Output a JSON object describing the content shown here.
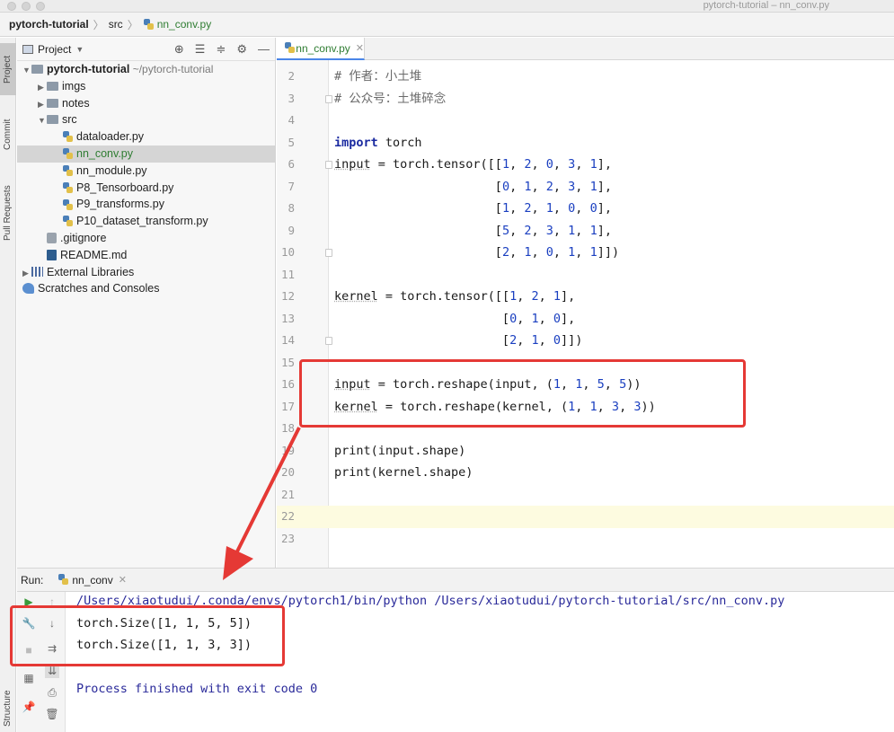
{
  "window": {
    "title": "pytorch-tutorial – nn_conv.py"
  },
  "breadcrumb": {
    "project": "pytorch-tutorial",
    "folder": "src",
    "file": "nn_conv.py"
  },
  "tool_stripe": {
    "project_tab": "Project",
    "commit_tab": "Commit",
    "pull_requests_tab": "Pull Requests",
    "structure_tab": "Structure"
  },
  "project_panel": {
    "header_label": "Project",
    "tree": [
      {
        "label": "pytorch-tutorial",
        "hint": "~/pytorch-tutorial",
        "kind": "folder",
        "expanded": true,
        "depth": 0
      },
      {
        "label": "imgs",
        "kind": "folder",
        "expanded": false,
        "depth": 1
      },
      {
        "label": "notes",
        "kind": "folder",
        "expanded": false,
        "depth": 1
      },
      {
        "label": "src",
        "kind": "folder",
        "expanded": true,
        "depth": 1
      },
      {
        "label": "dataloader.py",
        "kind": "py",
        "depth": 2
      },
      {
        "label": "nn_conv.py",
        "kind": "py",
        "depth": 2,
        "selected": true
      },
      {
        "label": "nn_module.py",
        "kind": "py",
        "depth": 2
      },
      {
        "label": "P8_Tensorboard.py",
        "kind": "py",
        "depth": 2
      },
      {
        "label": "P9_transforms.py",
        "kind": "py",
        "depth": 2
      },
      {
        "label": "P10_dataset_transform.py",
        "kind": "py",
        "depth": 2
      },
      {
        "label": ".gitignore",
        "kind": "git",
        "depth": 1
      },
      {
        "label": "README.md",
        "kind": "md",
        "depth": 1
      },
      {
        "label": "External Libraries",
        "kind": "lib",
        "depth": 0
      },
      {
        "label": "Scratches and Consoles",
        "kind": "scratch",
        "depth": 0
      }
    ]
  },
  "editor": {
    "tab_label": "nn_conv.py",
    "current_line": "22",
    "lines": [
      {
        "n": "2",
        "text": "# 作者：小土堆"
      },
      {
        "n": "3",
        "text": "# 公众号：土堆碎念"
      },
      {
        "n": "4",
        "text": ""
      },
      {
        "n": "5",
        "text": "import torch"
      },
      {
        "n": "6",
        "text": "input = torch.tensor([[1, 2, 0, 3, 1],"
      },
      {
        "n": "7",
        "text": "                      [0, 1, 2, 3, 1],"
      },
      {
        "n": "8",
        "text": "                      [1, 2, 1, 0, 0],"
      },
      {
        "n": "9",
        "text": "                      [5, 2, 3, 1, 1],"
      },
      {
        "n": "10",
        "text": "                      [2, 1, 0, 1, 1]])"
      },
      {
        "n": "11",
        "text": ""
      },
      {
        "n": "12",
        "text": "kernel = torch.tensor([[1, 2, 1],"
      },
      {
        "n": "13",
        "text": "                       [0, 1, 0],"
      },
      {
        "n": "14",
        "text": "                       [2, 1, 0]])"
      },
      {
        "n": "15",
        "text": ""
      },
      {
        "n": "16",
        "text": "input = torch.reshape(input, (1, 1, 5, 5))"
      },
      {
        "n": "17",
        "text": "kernel = torch.reshape(kernel, (1, 1, 3, 3))"
      },
      {
        "n": "18",
        "text": ""
      },
      {
        "n": "19",
        "text": "print(input.shape)"
      },
      {
        "n": "20",
        "text": "print(kernel.shape)"
      },
      {
        "n": "21",
        "text": ""
      },
      {
        "n": "22",
        "text": ""
      },
      {
        "n": "23",
        "text": ""
      }
    ]
  },
  "run_panel": {
    "label": "Run:",
    "tab_label": "nn_conv",
    "console": [
      {
        "kind": "path",
        "text": "/Users/xiaotudui/.conda/envs/pytorch1/bin/python /Users/xiaotudui/pytorch-tutorial/src/nn_conv.py"
      },
      {
        "kind": "out",
        "text": "torch.Size([1, 1, 5, 5])"
      },
      {
        "kind": "out",
        "text": "torch.Size([1, 1, 3, 3])"
      },
      {
        "kind": "blank",
        "text": ""
      },
      {
        "kind": "proc",
        "text": "Process finished with exit code 0"
      }
    ]
  },
  "colors": {
    "annotation_red": "#e53935",
    "keyword": "#1a2aa0",
    "number": "#1a3fc0",
    "current_line_bg": "#fdfbe0",
    "selection": "#d5d5d5"
  }
}
